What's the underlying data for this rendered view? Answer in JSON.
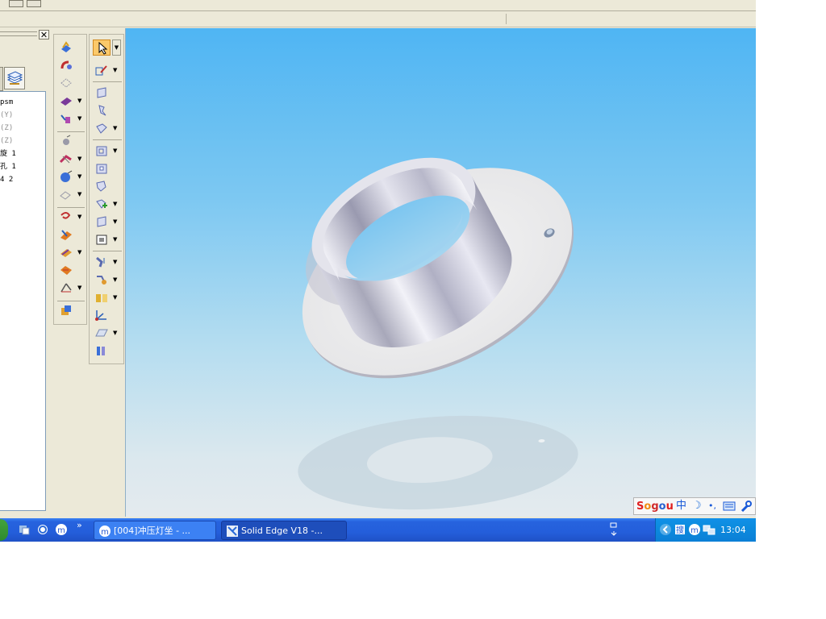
{
  "pathfinder": {
    "close_glyph": "✕",
    "tree_items": [
      {
        "text": "psm",
        "style": "normal"
      },
      {
        "text": "(Y)",
        "style": "dim"
      },
      {
        "text": "(Z)",
        "style": "dim"
      },
      {
        "text": "(Z)",
        "style": "dim"
      },
      {
        "text": "旋 1",
        "style": "normal"
      },
      {
        "text": "孔 1",
        "style": "normal"
      },
      {
        "text": "4 2",
        "style": "normal"
      }
    ]
  },
  "ime_bar": {
    "logo": "Sogou",
    "mode": "中",
    "moon": "☽",
    "punct": "•,",
    "colors": {
      "s": "#e02020",
      "o": "#f08a10",
      "g": "#d02a2a",
      "u": "#2a62d0"
    }
  },
  "taskbar": {
    "quicklaunch_more": "»",
    "tasks": [
      {
        "label": "[004]冲压灯坐 - ...",
        "icon": "browser-icon",
        "active": false
      },
      {
        "label": "Solid Edge V18 -...",
        "icon": "solid-edge-icon",
        "active": true
      }
    ],
    "clock": "13:04"
  },
  "colors": {
    "accent": "#245edb",
    "viewport_top": "#4fb5f3",
    "viewport_bottom": "#e4eaee",
    "part_face": "#f0f0f0",
    "part_cylinder": "#b9b9c9"
  }
}
